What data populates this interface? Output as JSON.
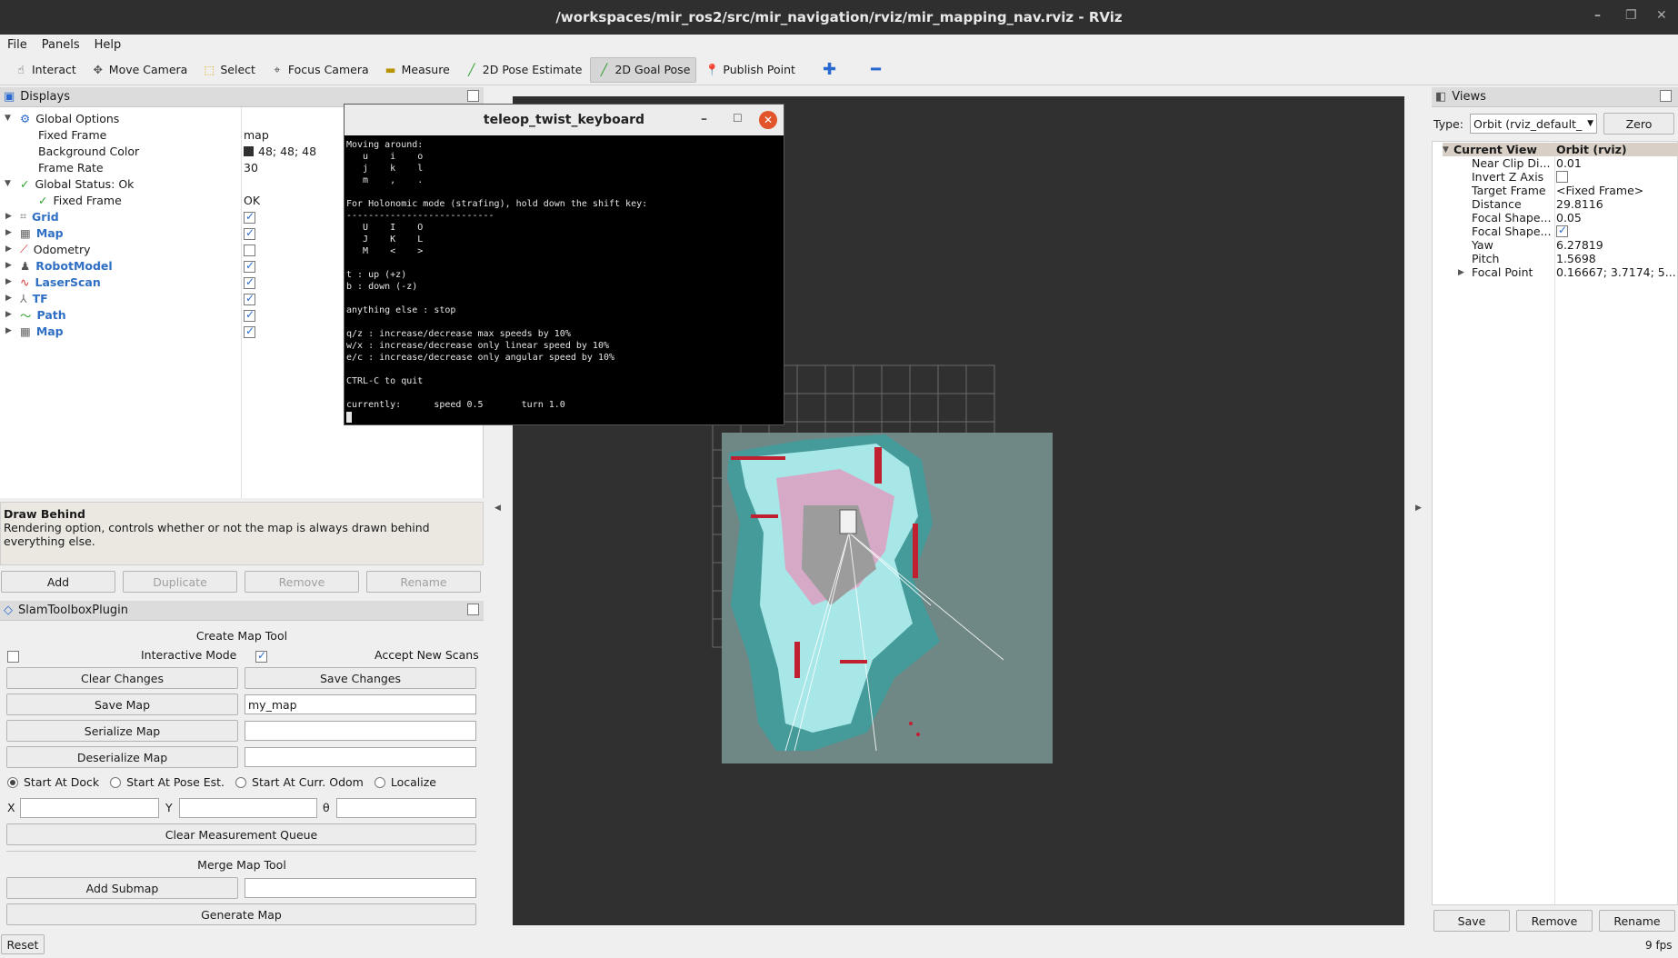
{
  "window": {
    "title": "/workspaces/mir_ros2/src/mir_navigation/rviz/mir_mapping_nav.rviz - RViz"
  },
  "menu": [
    "File",
    "Panels",
    "Help"
  ],
  "toolbar": [
    {
      "label": "Interact",
      "icon": "cursor-icon"
    },
    {
      "label": "Move Camera",
      "icon": "move-camera-icon"
    },
    {
      "label": "Select",
      "icon": "select-icon"
    },
    {
      "label": "Focus Camera",
      "icon": "focus-camera-icon"
    },
    {
      "label": "Measure",
      "icon": "measure-icon"
    },
    {
      "label": "2D Pose Estimate",
      "icon": "pose-estimate-icon"
    },
    {
      "label": "2D Goal Pose",
      "icon": "goal-pose-icon",
      "active": true
    },
    {
      "label": "Publish Point",
      "icon": "publish-point-icon"
    }
  ],
  "displays": {
    "title": "Displays",
    "rows": [
      {
        "label": "Global Options",
        "value": ""
      },
      {
        "label": "Fixed Frame",
        "value": "map"
      },
      {
        "label": "Background Color",
        "value": "48; 48; 48"
      },
      {
        "label": "Frame Rate",
        "value": "30"
      },
      {
        "label": "Global Status: Ok",
        "value": ""
      },
      {
        "label": "Fixed Frame",
        "value": "OK"
      },
      {
        "label": "Grid",
        "checked": true
      },
      {
        "label": "Map",
        "checked": true
      },
      {
        "label": "Odometry",
        "checked": false
      },
      {
        "label": "RobotModel",
        "checked": true
      },
      {
        "label": "LaserScan",
        "checked": true
      },
      {
        "label": "TF",
        "checked": true
      },
      {
        "label": "Path",
        "checked": true
      },
      {
        "label": "Map",
        "checked": true
      }
    ],
    "desc_title": "Draw Behind",
    "desc_text": "Rendering option, controls whether or not the map is always drawn behind everything else.",
    "buttons": [
      "Add",
      "Duplicate",
      "Remove",
      "Rename"
    ]
  },
  "slam": {
    "title": "SlamToolboxPlugin",
    "create_title": "Create Map Tool",
    "interactive_mode": "Interactive Mode",
    "accept_new_scans": "Accept New Scans",
    "clear_changes": "Clear Changes",
    "save_changes": "Save Changes",
    "save_map": "Save Map",
    "map_name": "my_map",
    "serialize_map": "Serialize Map",
    "deserialize_map": "Deserialize Map",
    "start_options": [
      "Start At Dock",
      "Start At Pose Est.",
      "Start At Curr. Odom",
      "Localize"
    ],
    "x_label": "X",
    "y_label": "Y",
    "theta_label": "θ",
    "clear_queue": "Clear Measurement Queue",
    "merge_title": "Merge Map Tool",
    "add_submap": "Add Submap",
    "generate_map": "Generate Map"
  },
  "reset": "Reset",
  "fps": "9 fps",
  "terminal": {
    "title": "teleop_twist_keyboard",
    "text": "Moving around:\n   u    i    o\n   j    k    l\n   m    ,    .\n\nFor Holonomic mode (strafing), hold down the shift key:\n---------------------------\n   U    I    O\n   J    K    L\n   M    <    >\n\nt : up (+z)\nb : down (-z)\n\nanything else : stop\n\nq/z : increase/decrease max speeds by 10%\nw/x : increase/decrease only linear speed by 10%\ne/c : increase/decrease only angular speed by 10%\n\nCTRL-C to quit\n\ncurrently:      speed 0.5       turn 1.0"
  },
  "views": {
    "title": "Views",
    "type_label": "Type:",
    "type_value": "Orbit (rviz_default_",
    "zero": "Zero",
    "current_view": "Current View",
    "current_view_value": "Orbit (rviz)",
    "props": [
      {
        "label": "Near Clip Di...",
        "value": "0.01"
      },
      {
        "label": "Invert Z Axis",
        "value": "",
        "checkbox": false
      },
      {
        "label": "Target Frame",
        "value": "<Fixed Frame>"
      },
      {
        "label": "Distance",
        "value": "29.8116"
      },
      {
        "label": "Focal Shape...",
        "value": "0.05"
      },
      {
        "label": "Focal Shape...",
        "value": "",
        "checkbox": true
      },
      {
        "label": "Yaw",
        "value": "6.27819"
      },
      {
        "label": "Pitch",
        "value": "1.5698"
      },
      {
        "label": "Focal Point",
        "value": "0.16667; 3.7174; 5..."
      }
    ],
    "buttons": [
      "Save",
      "Remove",
      "Rename"
    ]
  }
}
